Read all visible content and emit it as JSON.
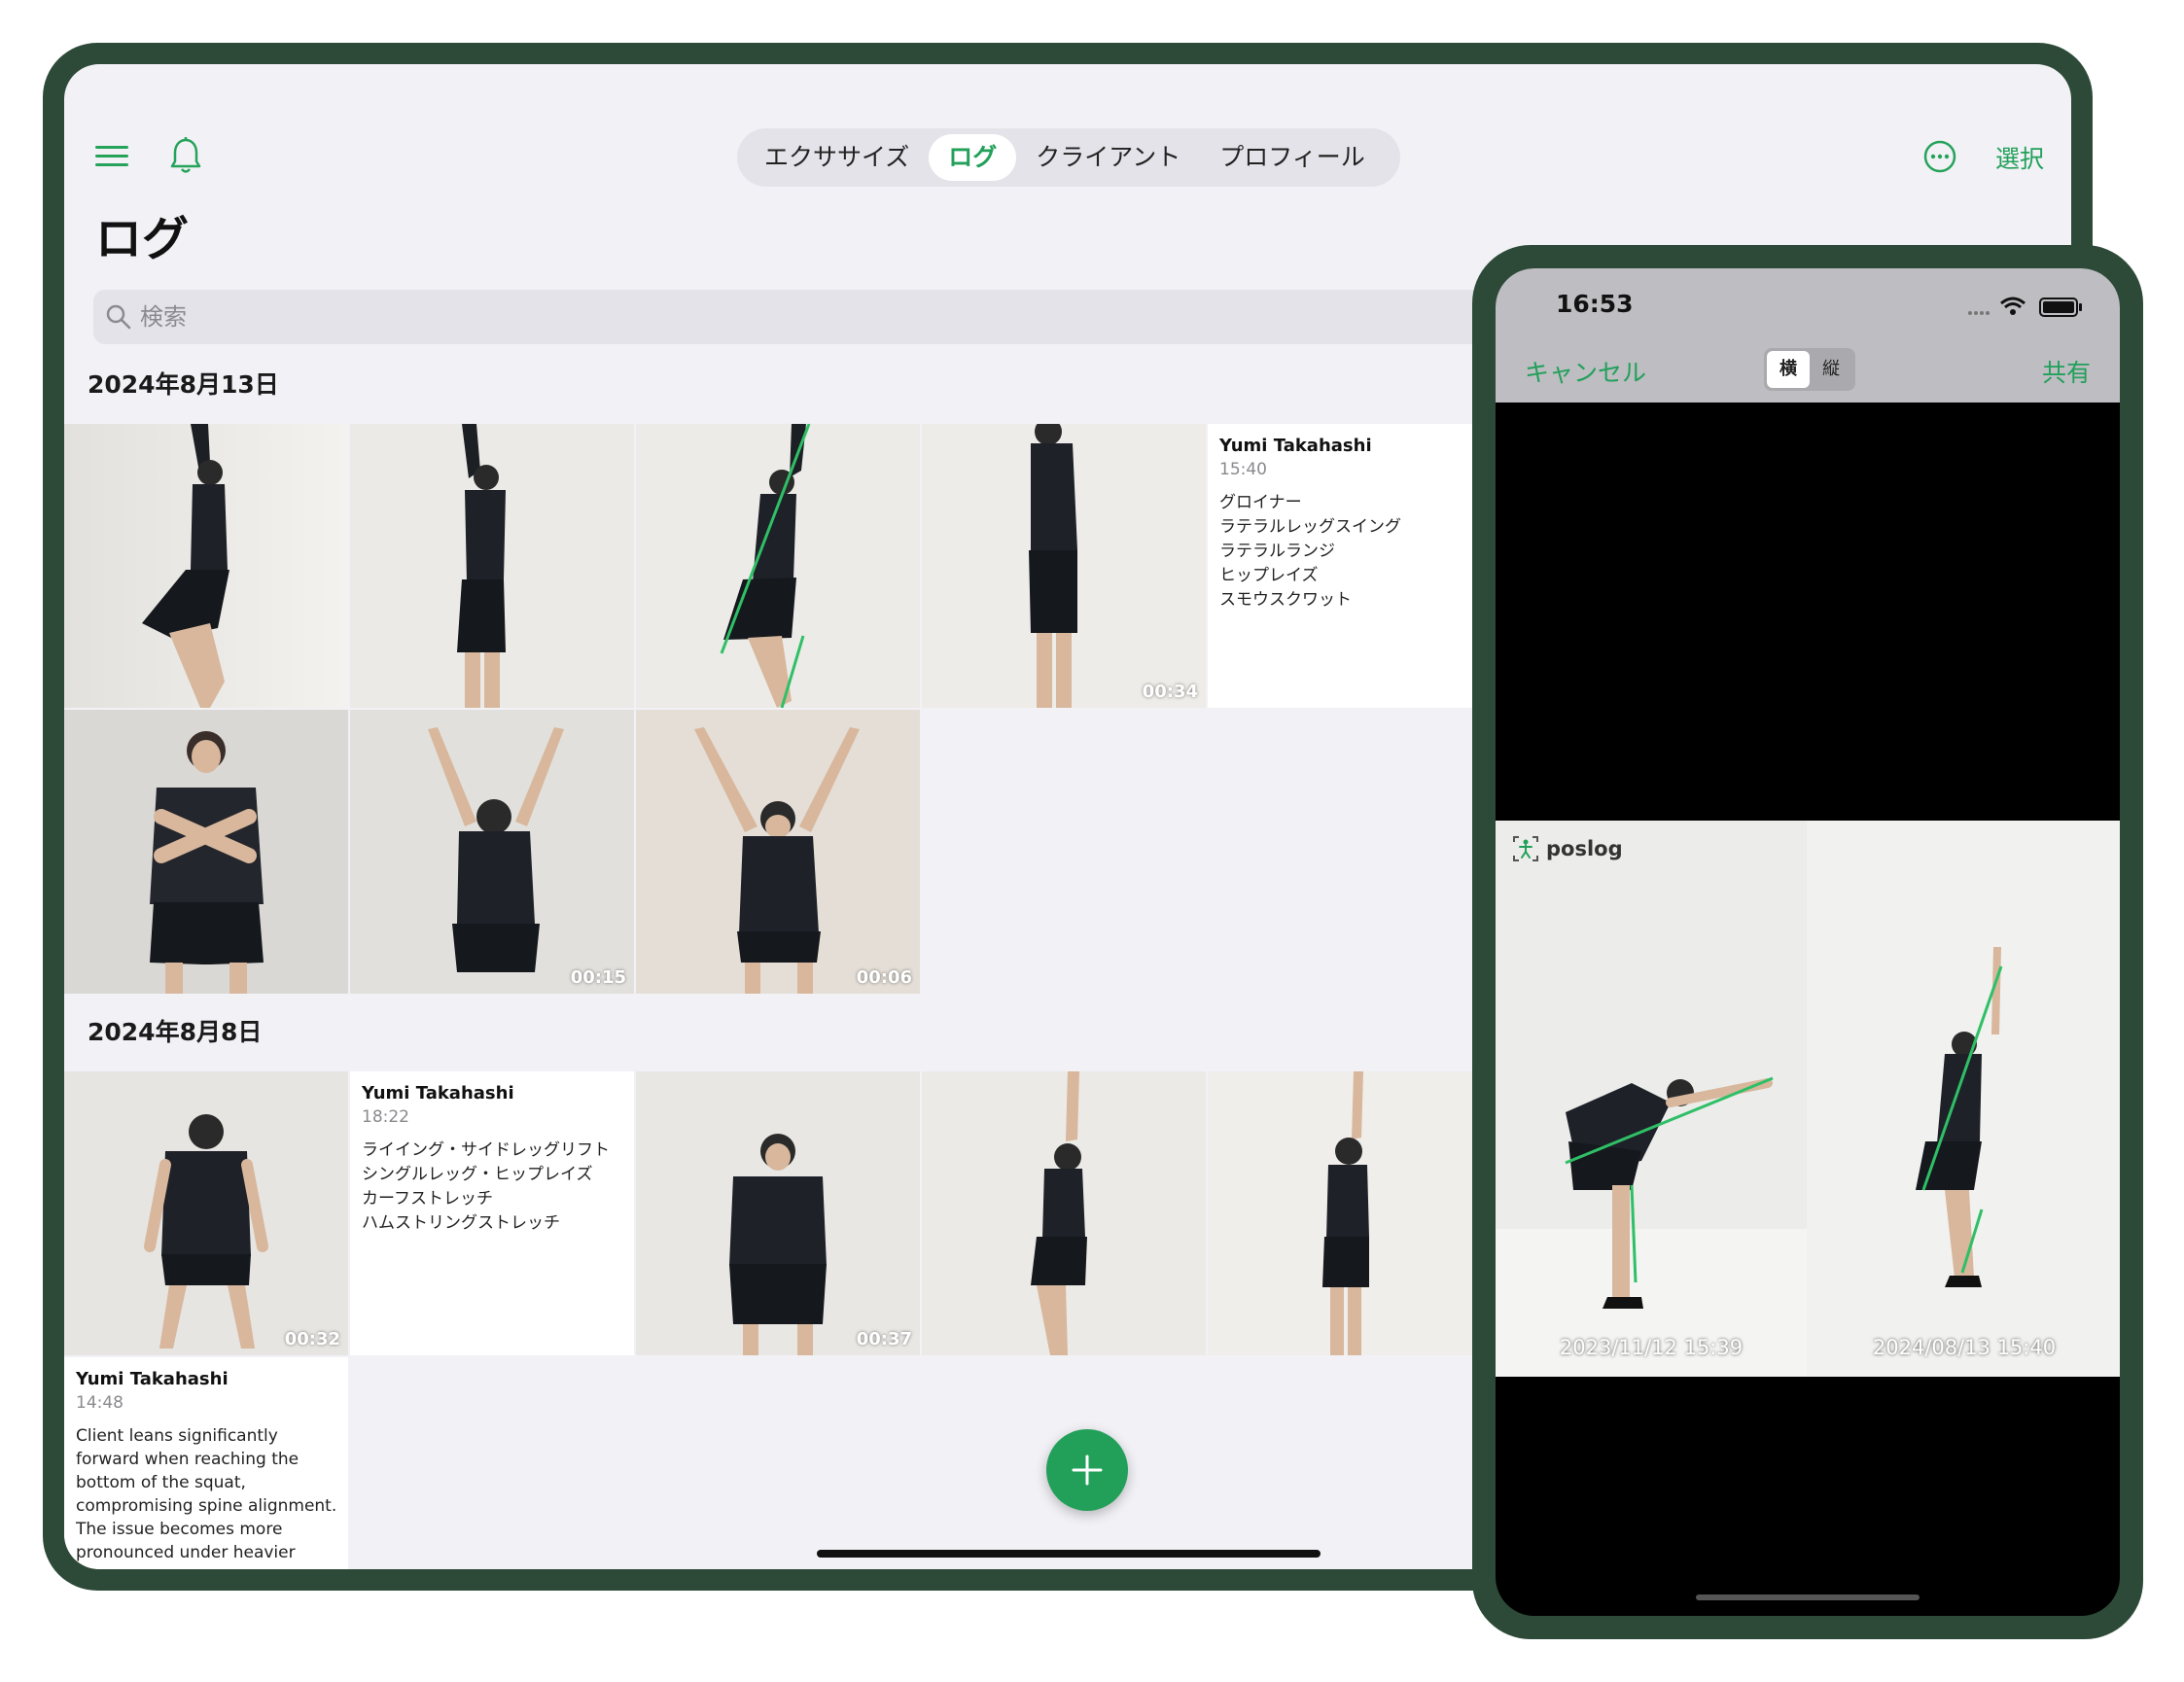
{
  "tablet": {
    "tabs": [
      "エクササイズ",
      "ログ",
      "クライアント",
      "プロフィール"
    ],
    "active_tab": 1,
    "select_label": "選択",
    "page_title": "ログ",
    "search": {
      "placeholder": "検索"
    },
    "sections": [
      {
        "date": "2024年8月13日",
        "durations": [
          "00:34",
          "00:15",
          "00:06"
        ],
        "note": {
          "name": "Yumi Takahashi",
          "time": "15:40",
          "items": [
            "グロイナー",
            "ラテラルレッグスイング",
            "ラテラルランジ",
            "ヒップレイズ",
            "スモウスクワット"
          ]
        }
      },
      {
        "date": "2024年8月8日",
        "durations": [
          "00:32",
          "00:37"
        ],
        "note": {
          "name": "Yumi Takahashi",
          "time": "18:22",
          "items": [
            "ライイング・サイドレッグリフト",
            "シングルレッグ・ヒップレイズ",
            "カーフストレッチ",
            "ハムストリングストレッチ"
          ]
        },
        "note2": {
          "name": "Yumi Takahashi",
          "time": "14:48",
          "text": "Client leans significantly forward when reaching the bottom of the squat, compromising spine alignment. The issue becomes more pronounced under heavier"
        }
      }
    ]
  },
  "phone": {
    "clock": "16:53",
    "cancel_label": "キャンセル",
    "share_label": "共有",
    "orientation": [
      "横",
      "縦"
    ],
    "brand": "poslog",
    "compare_dates": [
      "2023/11/12 15:39",
      "2024/08/13 15:40"
    ]
  },
  "colors": {
    "accent": "#22a05a",
    "frame": "#2d4a38",
    "background": "#f2f1f6"
  }
}
